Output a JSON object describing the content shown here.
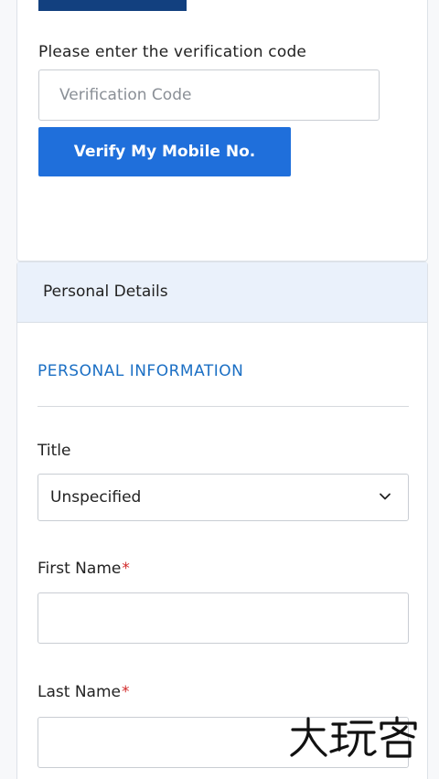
{
  "verification": {
    "prompt_label": "Please enter the verification code",
    "code_placeholder": "Verification Code",
    "code_value": "",
    "verify_button_label": "Verify My Mobile No."
  },
  "personal_details": {
    "header_title": "Personal Details",
    "section_title": "PERSONAL INFORMATION",
    "fields": {
      "title": {
        "label": "Title",
        "selected_value": "Unspecified"
      },
      "first_name": {
        "label": "First Name",
        "required_marker": "*",
        "value": ""
      },
      "last_name": {
        "label": "Last Name",
        "required_marker": "*",
        "value": ""
      }
    }
  },
  "watermark_text": "大玩客",
  "colors": {
    "primary_button": "#1f6fdb",
    "section_title": "#1b6fc4",
    "header_background": "#eaf1fb",
    "required_marker": "#d22a2a",
    "top_bar": "#12407f"
  }
}
